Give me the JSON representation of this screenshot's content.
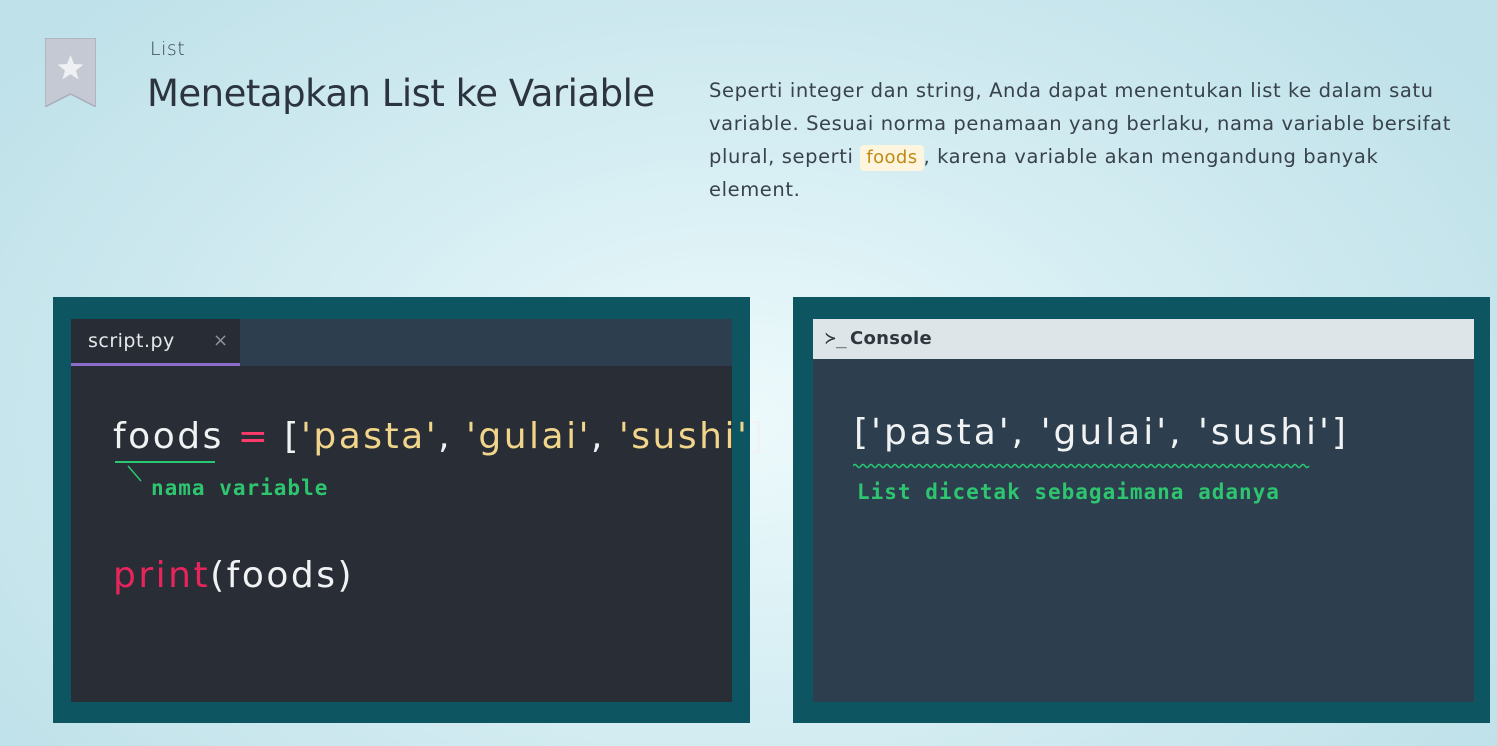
{
  "header": {
    "section_label": "List",
    "title": "Menetapkan List ke Variable",
    "bookmark_icon": "star-bookmark-icon"
  },
  "description": {
    "part1": "Seperti integer dan string, Anda dapat menentukan list ke dalam satu variable. Sesuai norma penamaan yang berlaku, nama variable bersifat plural, seperti ",
    "code": "foods",
    "part2": ", karena variable akan mengandung banyak element."
  },
  "editor": {
    "tab_label": "script.py",
    "tab_close": "×",
    "line1": {
      "var": "foods",
      "op": " = ",
      "open": "[",
      "s1": "'pasta'",
      "c1": ", ",
      "s2": "'gulai'",
      "c2": ", ",
      "s3": "'sushi'",
      "close": "]"
    },
    "line2": {
      "fn": "print",
      "args": "(foods)"
    },
    "annotation": "nama variable"
  },
  "console": {
    "prompt": "≻_",
    "title": "Console",
    "output": "['pasta', 'gulai', 'sushi']",
    "annotation": "List dicetak sebagaimana adanya"
  },
  "colors": {
    "panel_bg": "#0d5561",
    "editor_bg": "#292d36",
    "console_bg": "#2d3e4f",
    "tab_accent": "#8c6dcb",
    "annotation": "#2ec56f",
    "string": "#f0d58a",
    "keyword": "#e8245c"
  }
}
